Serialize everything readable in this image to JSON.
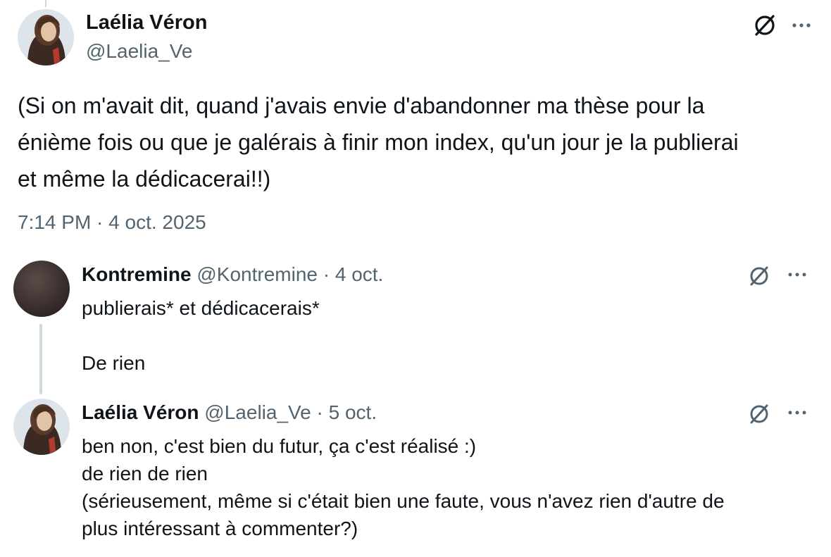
{
  "main_tweet": {
    "author_name": "Laélia Véron",
    "author_handle": "@Laelia_Ve",
    "text_lines": [
      "(Si on m'avait dit, quand j'avais envie d'abandonner ma thèse pour la",
      "énième fois ou que je galérais à finir mon index, qu'un jour je la publierai",
      "et même la dédicacerai!!)"
    ],
    "timestamp": "7:14 PM · 4 oct. 2025",
    "icons": {
      "grok": "grok-icon",
      "more": "more-dots-icon"
    }
  },
  "replies": [
    {
      "author_name": "Kontremine",
      "author_handle": "@Kontremine",
      "separator": "·",
      "date": "4 oct.",
      "text_lines": [
        "publierais* et dédicacerais*",
        "",
        "De rien"
      ]
    },
    {
      "author_name": "Laélia Véron",
      "author_handle": "@Laelia_Ve",
      "separator": "·",
      "date": "5 oct.",
      "text_lines": [
        "ben non, c'est bien du futur, ça c'est réalisé :)",
        "de rien de rien",
        "(sérieusement, même si c'était bien une faute, vous n'avez rien d'autre de",
        "plus intéressant à commenter?)"
      ]
    }
  ],
  "colors": {
    "primary_text": "#0f1419",
    "secondary_text": "#536471",
    "thread_line": "#cfd9de",
    "background": "#ffffff"
  }
}
